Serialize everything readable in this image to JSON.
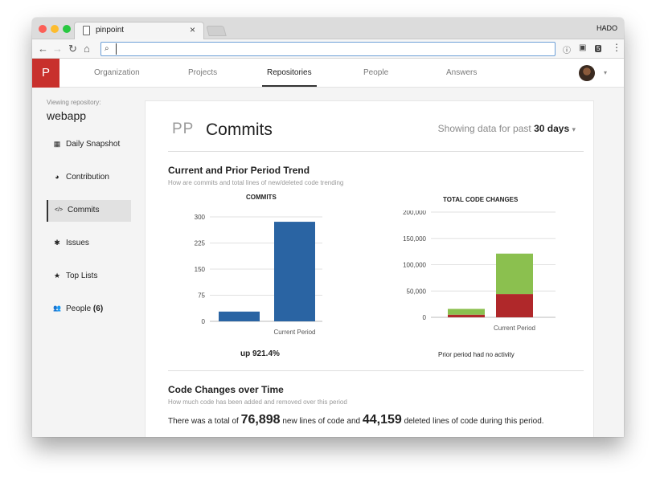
{
  "browser": {
    "tab_title": "pinpoint",
    "tab_close": "×",
    "user_label": "HADO",
    "address_value": "",
    "nav": {
      "back": "←",
      "forward": "→",
      "reload": "↻",
      "home": "⌂"
    },
    "extensions": {
      "info": "ⓘ",
      "ext": "▣",
      "badge": "5",
      "menu": "⋮"
    },
    "search_glyph": "⌕"
  },
  "app": {
    "logo": "P",
    "nav_items": [
      {
        "label": "Organization",
        "active": false
      },
      {
        "label": "Projects",
        "active": false
      },
      {
        "label": "Repositories",
        "active": true
      },
      {
        "label": "People",
        "active": false
      },
      {
        "label": "Answers",
        "active": false
      }
    ],
    "account_caret": "▾"
  },
  "sidebar": {
    "viewing_label": "Viewing repository:",
    "repo_name": "webapp",
    "items": [
      {
        "label": "Daily Snapshot",
        "icon": "calendar-icon",
        "glyph": "▦"
      },
      {
        "label": "Contribution",
        "icon": "pie-chart-icon",
        "glyph": "◕"
      },
      {
        "label": "Commits",
        "icon": "code-icon",
        "glyph": "</>",
        "active": true
      },
      {
        "label": "Issues",
        "icon": "bug-icon",
        "glyph": "✱"
      },
      {
        "label": "Top Lists",
        "icon": "star-icon",
        "glyph": "★"
      },
      {
        "label": "People",
        "count": "(6)",
        "icon": "users-icon",
        "glyph": "👥"
      }
    ]
  },
  "main": {
    "badge": "PP",
    "title": "Commits",
    "showing_prefix": "Showing data for past",
    "showing_period": "30 days",
    "showing_caret": "▾",
    "trend": {
      "title": "Current and Prior Period Trend",
      "subtitle": "How are commits and total lines of new/deleted code trending",
      "commits_stat": "up 921.4%",
      "code_note": "Prior period had no activity"
    },
    "changes": {
      "title": "Code Changes over Time",
      "subtitle": "How much code has been added and removed over this period",
      "text_1": "There was a total of",
      "added": "76,898",
      "text_2": "new lines of code and",
      "deleted": "44,159",
      "text_3": "deleted lines of code during this period."
    }
  },
  "colors": {
    "bar_blue": "#2a64a3",
    "bar_green": "#8bc04f",
    "bar_red": "#b0282a",
    "logo_red": "#c8302c"
  },
  "chart_data": [
    {
      "type": "bar",
      "title": "COMMITS",
      "categories": [
        "",
        "Current Period"
      ],
      "values": [
        28,
        286
      ],
      "ylim": [
        0,
        300
      ],
      "yticks": [
        "0",
        "75",
        "150",
        "225",
        "300"
      ],
      "ytick_values": [
        0,
        75,
        150,
        225,
        300
      ],
      "color": "#2a64a3",
      "grid": true
    },
    {
      "type": "bar",
      "stacked": true,
      "title": "TOTAL CODE CHANGES",
      "categories": [
        "",
        "Current Period"
      ],
      "series": [
        {
          "values": [
            5000,
            44159
          ],
          "color": "#b0282a"
        },
        {
          "values": [
            11000,
            76898
          ],
          "color": "#8bc04f"
        }
      ],
      "ylim": [
        0,
        200000
      ],
      "yticks": [
        "0",
        "50,000",
        "100,000",
        "150,000",
        "200,000"
      ],
      "ytick_values": [
        0,
        50000,
        100000,
        150000,
        200000
      ],
      "grid": true
    }
  ]
}
